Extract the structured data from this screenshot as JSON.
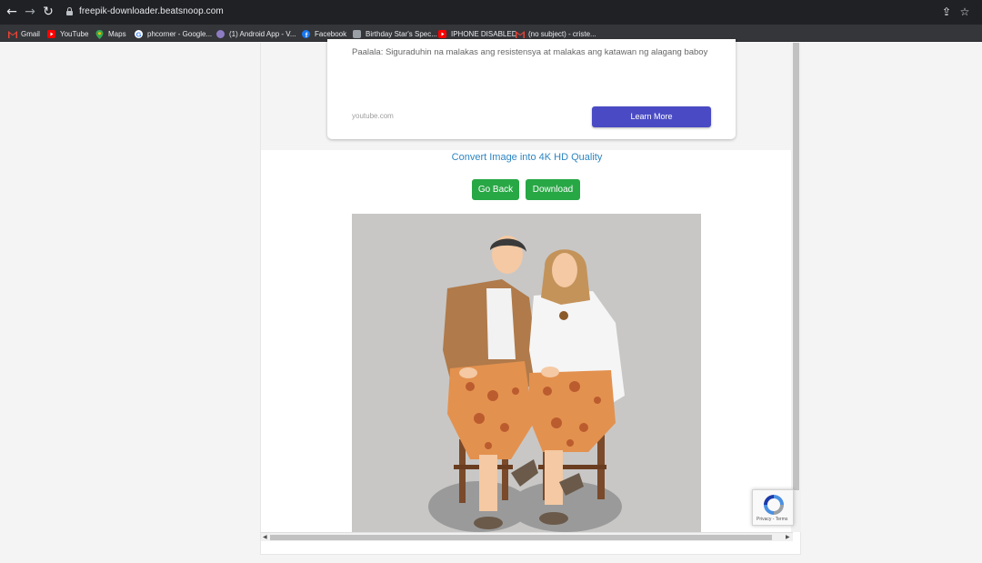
{
  "browser": {
    "url": "freepik-downloader.beatsnoop.com",
    "bookmarks": [
      {
        "label": "Gmail",
        "icon": "gmail-icon",
        "color": "#ea4335"
      },
      {
        "label": "YouTube",
        "icon": "youtube-icon",
        "color": "#ff0000"
      },
      {
        "label": "Maps",
        "icon": "maps-icon",
        "color": "#34a853"
      },
      {
        "label": "phcorner - Google...",
        "icon": "google-icon",
        "color": "#ffffff"
      },
      {
        "label": "(1) Android App - V...",
        "icon": "app-icon",
        "color": "#8e7cc3"
      },
      {
        "label": "Facebook",
        "icon": "facebook-icon",
        "color": "#1877f2"
      },
      {
        "label": "Birthday Star's Spec...",
        "icon": "page-icon",
        "color": "#9aa0a6"
      },
      {
        "label": "IPHONE DISABLED",
        "icon": "youtube-icon",
        "color": "#ff0000"
      },
      {
        "label": "(no subject) - criste...",
        "icon": "gmail-icon",
        "color": "#ea4335"
      }
    ]
  },
  "ad": {
    "text": "Paalala: Siguraduhin na malakas ang resistensya at malakas ang katawan ng alagang baboy",
    "source": "youtube.com",
    "cta": "Learn More"
  },
  "main": {
    "convert_link": "Convert Image into 4K HD Quality",
    "go_back": "Go Back",
    "download": "Download"
  },
  "recaptcha": {
    "terms": "Privacy - Terms"
  },
  "colors": {
    "accent_button": "#28a745",
    "ad_cta": "#4a4bc4",
    "link": "#2e86c1"
  }
}
